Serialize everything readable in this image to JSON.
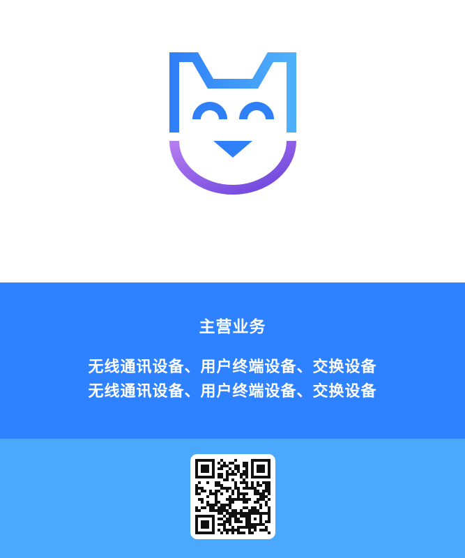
{
  "colors": {
    "logo_blue": "#2f7ff7",
    "logo_light_blue": "#4fb0fa",
    "logo_purple": "#b57df0",
    "logo_violet": "#6a43dc",
    "business_bg": "#2f82ff",
    "qr_bg": "#4aa9fc"
  },
  "logo": {
    "icon": "cat-face-icon"
  },
  "business": {
    "title": "主营业务",
    "line1": "无线通讯设备、用户终端设备、交换设备",
    "line2": "无线通讯设备、用户终端设备、交换设备"
  },
  "qr": {
    "icon": "qr-code-icon"
  }
}
